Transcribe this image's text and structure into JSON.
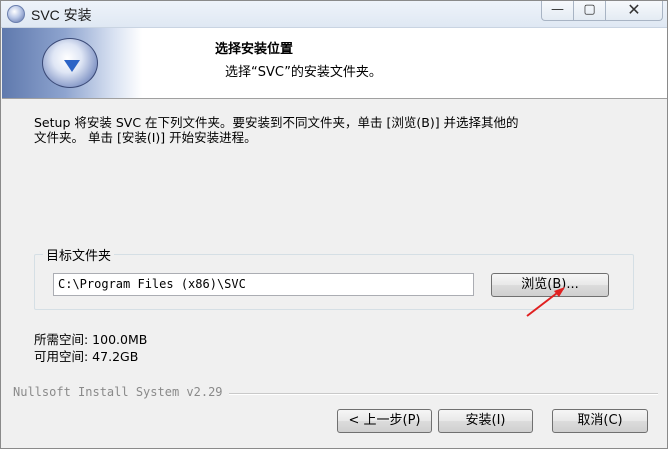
{
  "window": {
    "title": "SVC 安装",
    "controls": {
      "minimize": "—",
      "maximize": "▢",
      "close": "✕"
    }
  },
  "header": {
    "title": "选择安装位置",
    "subtitle": "选择“SVC”的安装文件夹。"
  },
  "description": "Setup 将安装 SVC 在下列文件夹。要安装到不同文件夹，单击 [浏览(B)] 并选择其他的\n文件夹。 单击 [安装(I)] 开始安装进程。",
  "destination": {
    "group_label": "目标文件夹",
    "path_value": "C:\\Program Files (x86)\\SVC",
    "browse_label": "浏览(B)..."
  },
  "space": {
    "required": "所需空间: 100.0MB",
    "available": "可用空间: 47.2GB"
  },
  "branding": "Nullsoft Install System v2.29",
  "buttons": {
    "back": "< 上一步(P)",
    "install": "安装(I)",
    "cancel": "取消(C)"
  },
  "colors": {
    "annotation_arrow": "#e02020",
    "dialog_bg": "#f0f0f0"
  }
}
